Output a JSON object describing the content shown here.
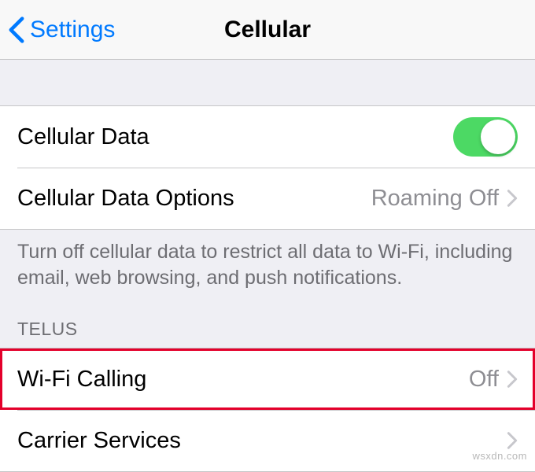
{
  "nav": {
    "back_label": "Settings",
    "title": "Cellular"
  },
  "rows": {
    "cellular_data": {
      "label": "Cellular Data",
      "on": true
    },
    "cellular_data_options": {
      "label": "Cellular Data Options",
      "value": "Roaming Off"
    },
    "footer": "Turn off cellular data to restrict all data to Wi-Fi, including email, web browsing, and push notifications.",
    "carrier_header": "TELUS",
    "wifi_calling": {
      "label": "Wi-Fi Calling",
      "value": "Off"
    },
    "carrier_services": {
      "label": "Carrier Services"
    }
  },
  "watermark": "wsxdn.com"
}
